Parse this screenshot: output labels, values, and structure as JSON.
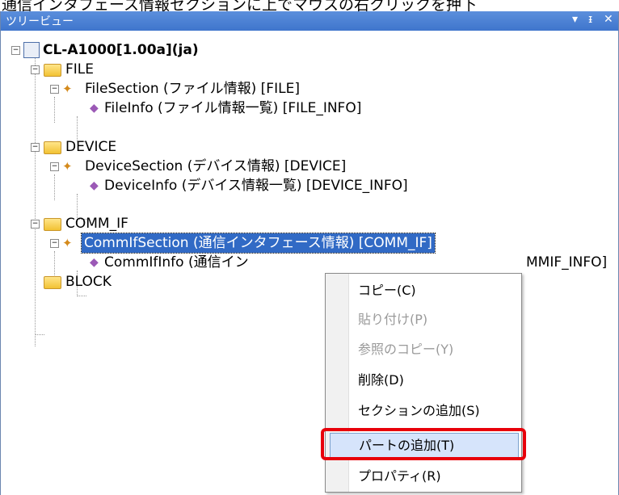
{
  "header_strip": {
    "text": "通信インタフェース情報セクションに上でマウスの右クリックを押下"
  },
  "panel": {
    "title": "ツリービュー",
    "controls": [
      "▾",
      "ᵻ",
      "✕"
    ]
  },
  "tree": {
    "root": "CL-A1000[1.00a](ja)",
    "file": "FILE",
    "file_section": "FileSection (ファイル情報) [FILE]",
    "file_info": "FileInfo (ファイル情報一覧) [FILE_INFO]",
    "device": "DEVICE",
    "device_section": "DeviceSection (デバイス情報) [DEVICE]",
    "device_info": "DeviceInfo (デバイス情報一覧) [DEVICE_INFO]",
    "comm_if": "COMM_IF",
    "comm_section": "CommIfSection (通信インタフェース情報) [COMM_IF]",
    "comm_info_left": "CommIfInfo (通信イン",
    "comm_info_right": "MMIF_INFO]",
    "block": "BLOCK"
  },
  "context_menu": {
    "items": [
      {
        "label": "コピー(C)",
        "enabled": true
      },
      {
        "label": "貼り付け(P)",
        "enabled": false
      },
      {
        "label": "参照のコピー(Y)",
        "enabled": false
      },
      {
        "label": "削除(D)",
        "enabled": true
      },
      {
        "label": "セクションの追加(S)",
        "enabled": true
      },
      {
        "label": "パートの追加(T)",
        "enabled": true,
        "highlighted": true
      },
      {
        "label": "プロパティ(R)",
        "enabled": true
      }
    ]
  },
  "colors": {
    "title_bar": "#3f75cc",
    "selection": "#316ac5",
    "highlight_border": "#e8000a"
  }
}
